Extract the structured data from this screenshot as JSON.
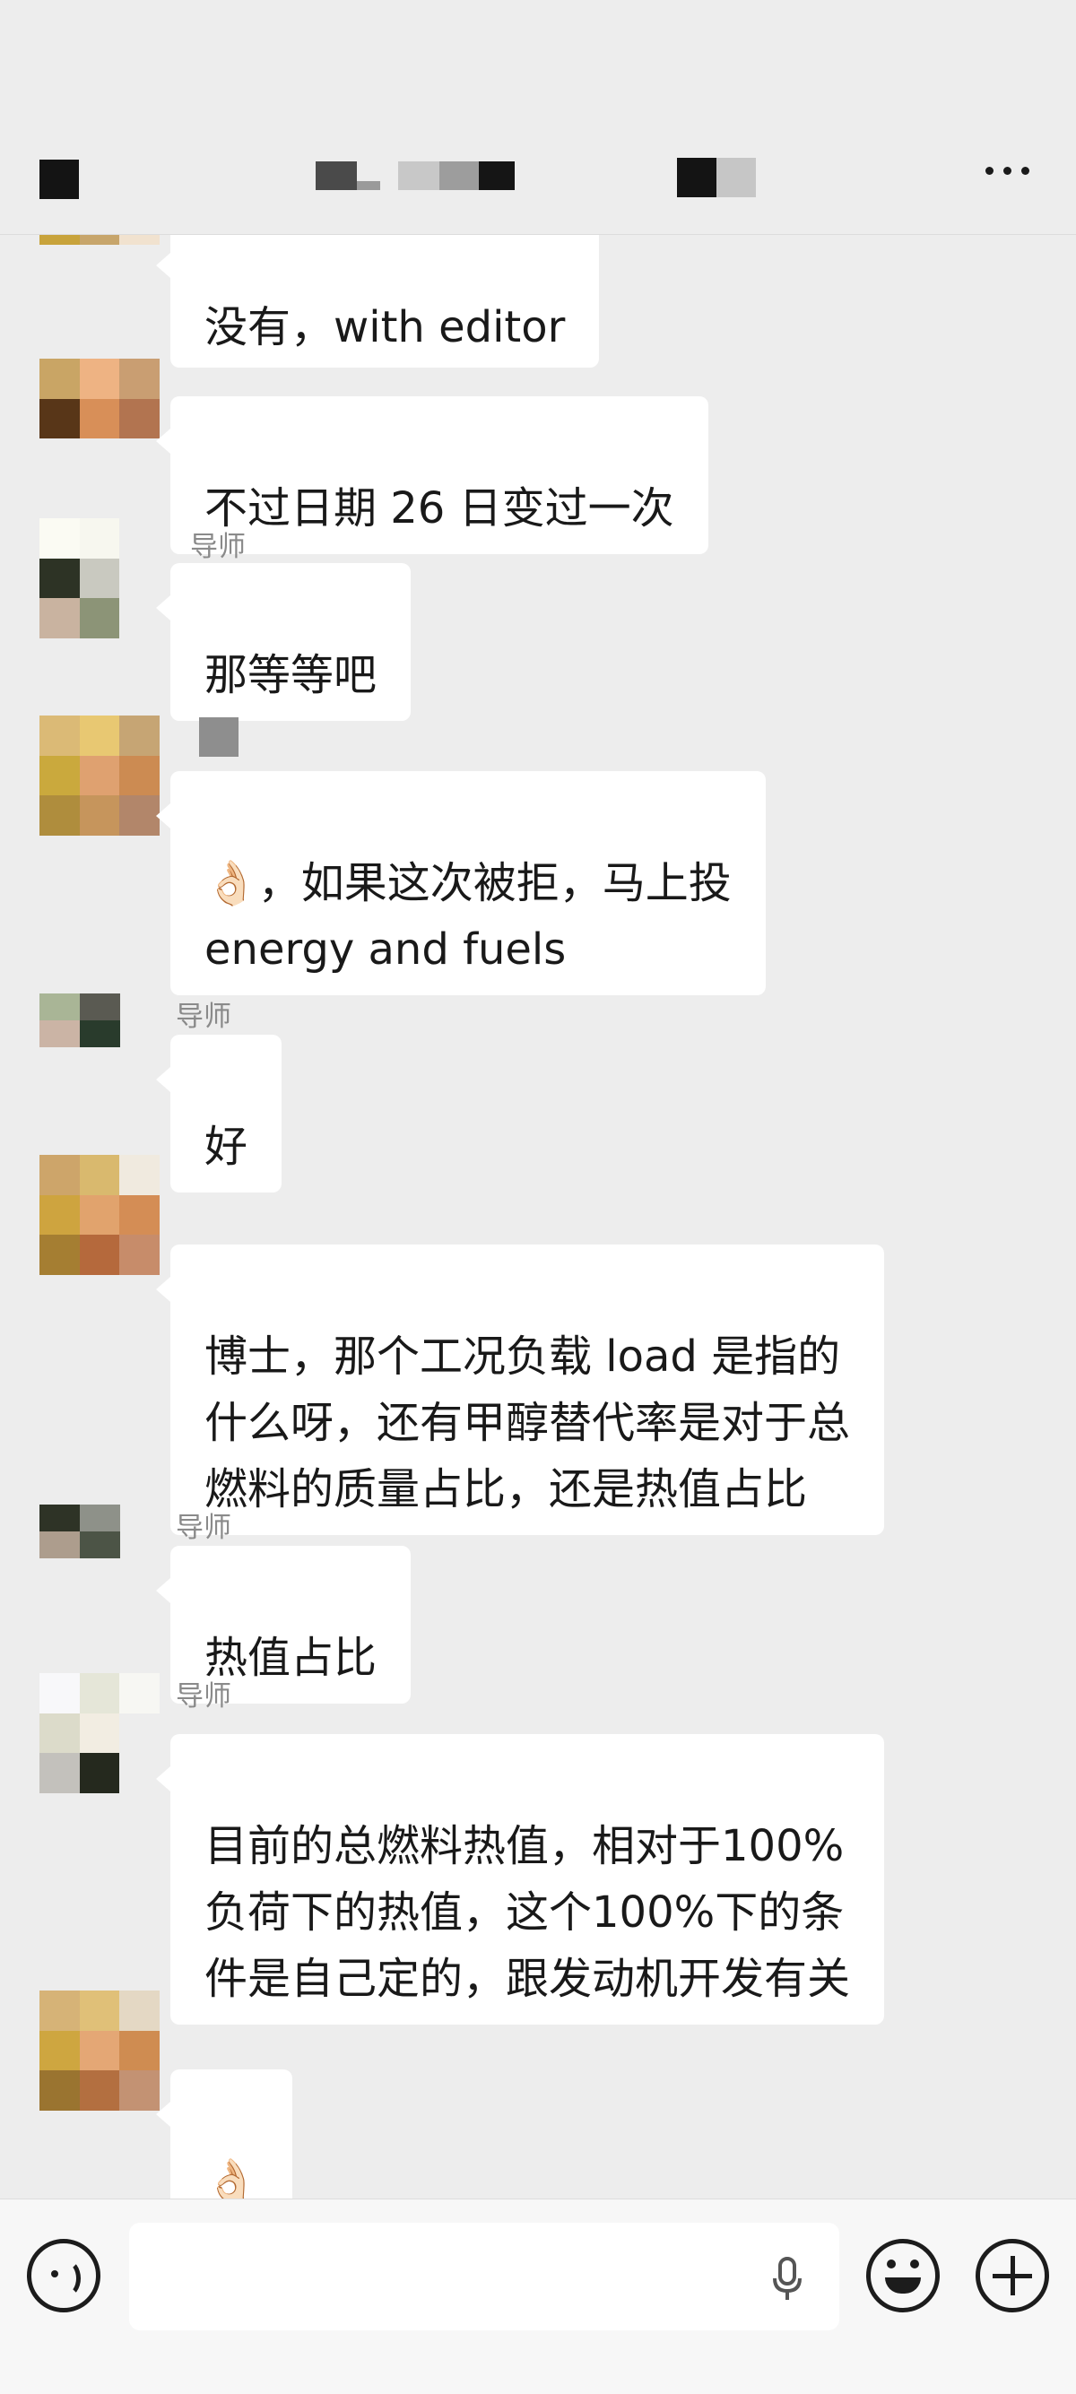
{
  "header": {
    "title_obscured": true,
    "more_icon": "more-dots-icon",
    "back_icon": "back-icon"
  },
  "messages": [
    {
      "sender": "",
      "text": "没有，with editor",
      "avatar_colors": [
        "#c8a33b",
        "#c7a56b",
        "#f1e2cf",
        "#ededed",
        "#ededed",
        "#ededed",
        "#ededed",
        "#ededed",
        "#ededed"
      ]
    },
    {
      "sender": "",
      "text": "不过日期 26 日变过一次",
      "avatar_colors": [
        "#c9a565",
        "#eeb383",
        "#c99e72",
        "#583618",
        "#d88f58",
        "#b27450",
        "#ededed",
        "#ededed",
        "#ededed"
      ]
    },
    {
      "sender": "导师",
      "text": "那等等吧",
      "avatar_colors": [
        "#fbfbf3",
        "#f7f7ef",
        "#ededed",
        "#2d3325",
        "#c9c9c0",
        "#ededed",
        "#c9b3a0",
        "#8c9477",
        "#ededed"
      ]
    },
    {
      "sender": "",
      "text": "👌🏻，如果这次被拒，马上投\nenergy and fuels",
      "avatar_colors": [
        "#dbba76",
        "#e8c872",
        "#c6a574",
        "#caa93d",
        "#dfa170",
        "#cc8b52",
        "#af8d3d",
        "#c6955c",
        "#b2866a"
      ]
    },
    {
      "sender": "导师",
      "text": "好",
      "avatar_colors": [
        "#a9b596",
        "#5a5a52",
        "#ededed",
        "#cbb4a5",
        "#293b2c",
        "#ededed",
        "#ededed",
        "#ededed",
        "#ededed"
      ]
    },
    {
      "sender": "",
      "text": "博士，那个工况负载 load 是指的\n什么呀，还有甲醇替代率是对于总\n燃料的质量占比，还是热值占比",
      "avatar_colors": [
        "#cda56a",
        "#d9b96e",
        "#f0eadf",
        "#cea43f",
        "#e1a36d",
        "#d48d55",
        "#a57e32",
        "#b5693c",
        "#c78c6a"
      ]
    },
    {
      "sender": "导师",
      "text": "热值占比",
      "avatar_colors": [
        "#2e3326",
        "#8e9189",
        "#ededed",
        "#ad9d8d",
        "#4c5446",
        "#ededed",
        "#ededed",
        "#ededed",
        "#ededed"
      ]
    },
    {
      "sender": "导师",
      "text": "目前的总燃料热值，相对于100%\n负荷下的热值，这个100%下的条\n件是自己定的，跟发动机开发有关",
      "avatar_colors": [
        "#f8f8fa",
        "#e5e6d8",
        "#f7f7f3",
        "#dcdbca",
        "#f2ede2",
        "#ededed",
        "#c3c1bc",
        "#25291e",
        "#ededed"
      ]
    },
    {
      "sender": "",
      "text": "👌🏻",
      "avatar_colors": [
        "#d6b377",
        "#e0c078",
        "#e4d8c4",
        "#cea640",
        "#e4a775",
        "#cf8c51",
        "#9a7430",
        "#b36f40",
        "#c39273"
      ]
    }
  ],
  "input": {
    "placeholder": "",
    "voice_icon": "voice-icon",
    "mic_icon": "microphone-icon",
    "emoji_icon": "emoji-icon",
    "plus_icon": "plus-icon"
  }
}
